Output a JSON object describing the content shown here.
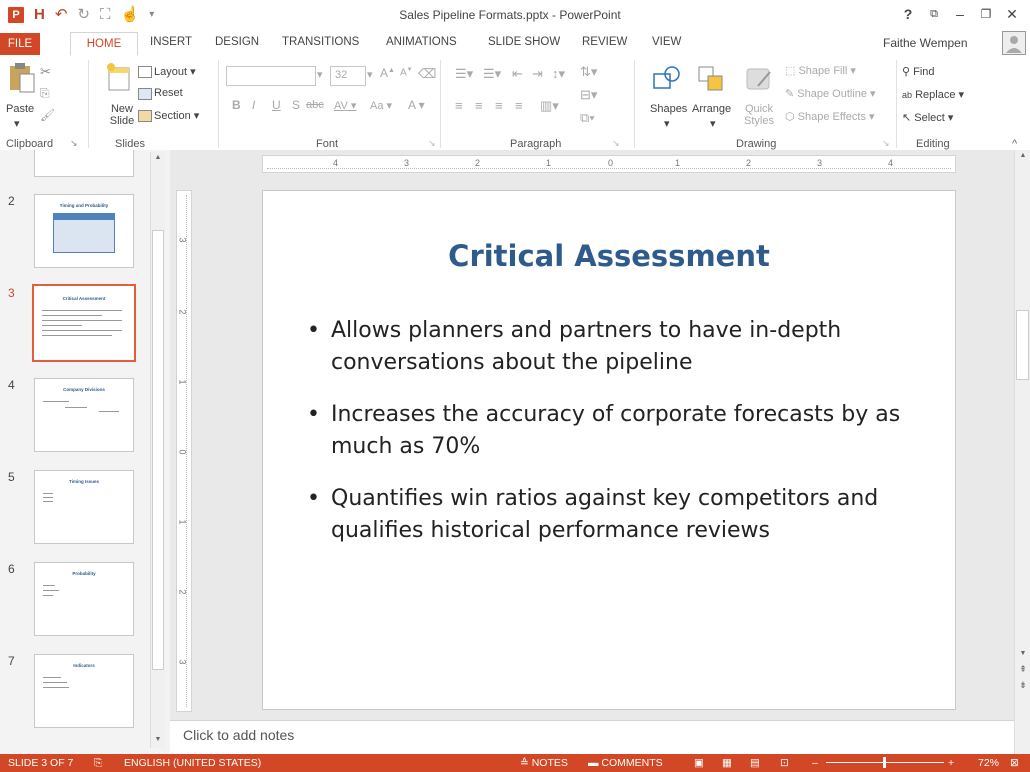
{
  "window": {
    "title": "Sales Pipeline Formats.pptx - PowerPoint",
    "help": "?",
    "restore": "⧉",
    "minimize": "–",
    "maximize": "❐",
    "close": "✕"
  },
  "qat": {
    "logo": "P",
    "save": "H",
    "undo": "↶",
    "redo": "↻"
  },
  "tabs": [
    "FILE",
    "HOME",
    "INSERT",
    "DESIGN",
    "TRANSITIONS",
    "ANIMATIONS",
    "SLIDE SHOW",
    "REVIEW",
    "VIEW"
  ],
  "user": "Faithe Wempen",
  "ribbon": {
    "clipboard": {
      "paste": "Paste",
      "label": "Clipboard"
    },
    "slides": {
      "new_slide": "New Slide",
      "layout": "Layout",
      "reset": "Reset",
      "section": "Section",
      "label": "Slides"
    },
    "font": {
      "size": "32",
      "label": "Font",
      "bold": "B",
      "italic": "I",
      "underline": "U",
      "strike": "S",
      "abc": "abc",
      "spacing": "AV",
      "case": "Aa",
      "grow": "A",
      "shrink": "A"
    },
    "paragraph": {
      "label": "Paragraph"
    },
    "drawing": {
      "shapes": "Shapes",
      "arrange": "Arrange",
      "quick_styles": "Quick Styles",
      "shape_fill": "Shape Fill",
      "shape_outline": "Shape Outline",
      "shape_effects": "Shape Effects",
      "label": "Drawing"
    },
    "editing": {
      "find": "Find",
      "replace": "Replace",
      "select": "Select",
      "label": "Editing"
    }
  },
  "thumbnails": [
    {
      "num": "2",
      "title": "Timing and Probability"
    },
    {
      "num": "3",
      "title": "Critical Assessment"
    },
    {
      "num": "4",
      "title": "Company Divisions"
    },
    {
      "num": "5",
      "title": "Timing Issues"
    },
    {
      "num": "6",
      "title": "Probability"
    },
    {
      "num": "7",
      "title": "Indicators"
    }
  ],
  "slide": {
    "title": "Critical Assessment",
    "bullets": [
      "Allows planners and partners to have in-depth conversations about the pipeline",
      "Increases the accuracy of corporate forecasts by as much as 70%",
      "Quantifies win ratios against key competitors and qualifies historical performance reviews"
    ]
  },
  "ruler": {
    "h_labels": [
      "4",
      "3",
      "2",
      "1",
      "0",
      "1",
      "2",
      "3",
      "4"
    ],
    "v_labels": [
      "3",
      "2",
      "1",
      "0",
      "1",
      "2",
      "3"
    ]
  },
  "notes_placeholder": "Click to add notes",
  "status": {
    "slide": "SLIDE 3 OF 7",
    "language": "ENGLISH (UNITED STATES)",
    "notes": "NOTES",
    "comments": "COMMENTS",
    "zoom": "72%"
  }
}
